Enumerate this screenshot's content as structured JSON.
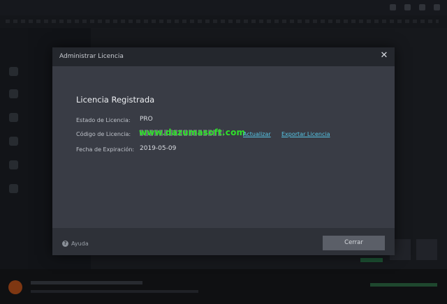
{
  "dialog": {
    "title": "Administrar Licencia",
    "heading": "Licencia Registrada",
    "status_label": "Estado de Licencia:",
    "status_value": "PRO",
    "code_label": "Código de Licencia:",
    "watermark": "www.dazumasoft.com",
    "update_link": "Actualizar",
    "export_link": "Exportar Licencia",
    "expiry_label": "Fecha de Expiración:",
    "expiry_value": "2019-05-09",
    "help_label": "Ayuda",
    "close_button": "Cerrar"
  },
  "icons": {
    "close": "close-icon",
    "help": "help-icon"
  },
  "colors": {
    "link": "#56c6e6",
    "watermark": "#2fe12a",
    "dialog_bg": "#393c45",
    "header_bg": "#24272d"
  }
}
